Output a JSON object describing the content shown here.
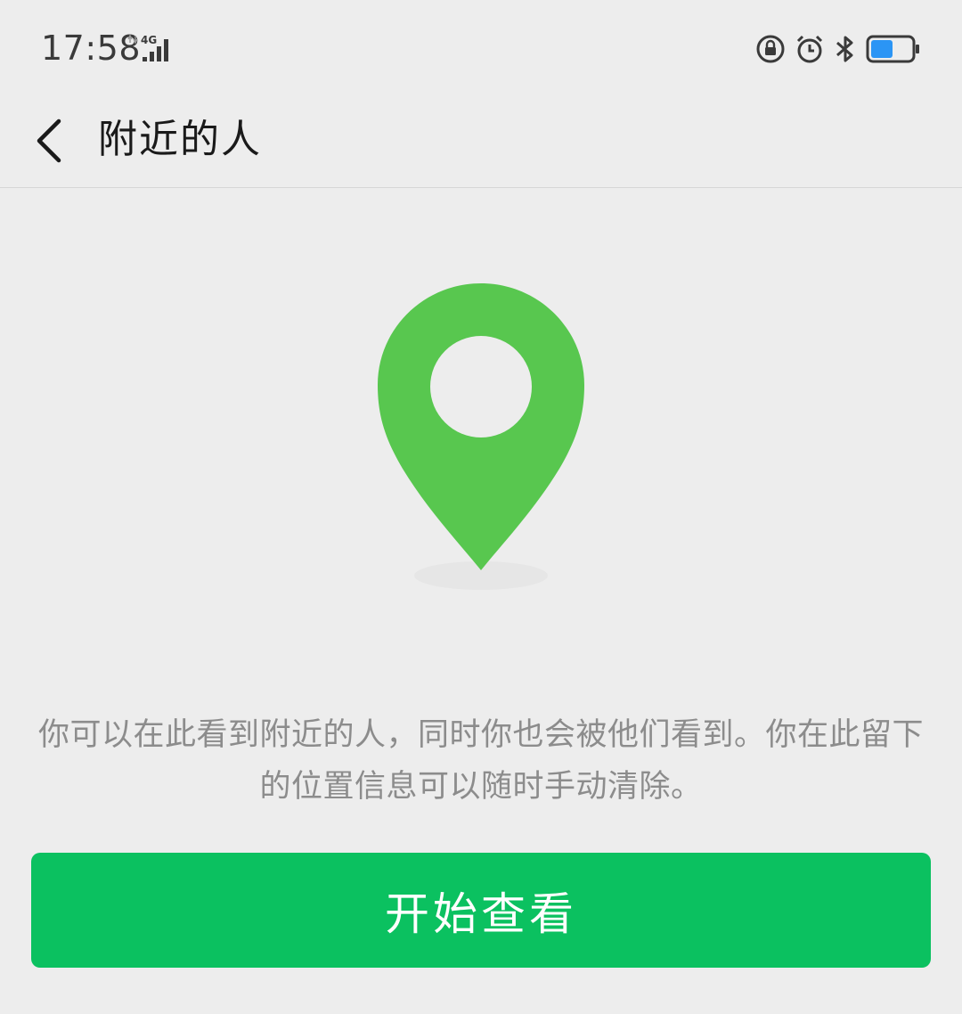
{
  "status_bar": {
    "time": "17:58",
    "network": "4G",
    "icons": [
      "lock-rotation-icon",
      "alarm-icon",
      "bluetooth-icon",
      "battery-icon"
    ],
    "battery_color": "#2b95f5"
  },
  "nav": {
    "back_icon": "chevron-left-icon",
    "title": "附近的人"
  },
  "main": {
    "pin_icon": "location-pin-icon",
    "pin_color": "#58c74f",
    "description": "你可以在此看到附近的人，同时你也会被他们看到。你在此留下的位置信息可以随时手动清除。"
  },
  "start_button": {
    "label": "开始查看",
    "color": "#0bc160"
  }
}
